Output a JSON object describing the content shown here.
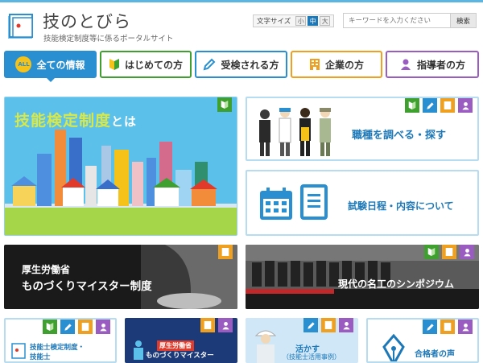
{
  "site": {
    "title": "技のとびら",
    "subtitle": "技能検定制度等に係るポータルサイト"
  },
  "font_size": {
    "label": "文字サイズ",
    "options": [
      "小",
      "中",
      "大"
    ],
    "selected": "中"
  },
  "search": {
    "placeholder": "キーワードを入力ください",
    "button_label": "検索"
  },
  "nav": {
    "tabs": [
      {
        "badge": "ALL",
        "label": "全ての情報",
        "active": true
      },
      {
        "label": "はじめての方"
      },
      {
        "label": "受検される方"
      },
      {
        "label": "企業の方"
      },
      {
        "label": "指導者の方"
      }
    ]
  },
  "cards": {
    "hero": {
      "title": "技能検定制度",
      "title_suffix": "とは"
    },
    "occupation": {
      "label": "職種を調べる・探す"
    },
    "schedule": {
      "label": "試験日程・内容について"
    },
    "meister": {
      "line1": "厚生労働省",
      "line2": "ものづくりマイスター制度"
    },
    "symposium": {
      "label": "現代の名工のシンポジウム"
    },
    "qualified": {
      "line1": "技能士検定制度・",
      "line2": "技能士"
    },
    "meister_small": {
      "line1": "厚生労働省",
      "line2": "ものづくりマイスター"
    },
    "utilize": {
      "line1": "活かす",
      "line2": "（技能士活用事例）"
    },
    "voices": {
      "label": "合格者の声"
    }
  },
  "colors": {
    "brand_blue": "#2a8fd0",
    "green": "#3fa030",
    "orange": "#f0a020",
    "purple": "#9a5cc0",
    "sky": "#5cc1ea"
  }
}
